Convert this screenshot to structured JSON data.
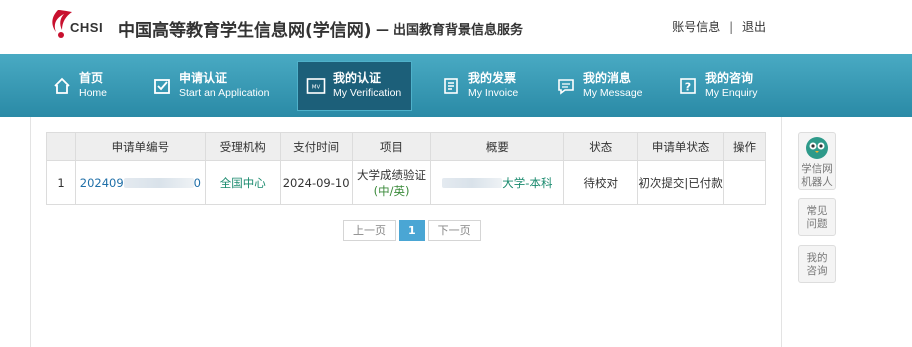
{
  "header": {
    "logo_text": "CHSI",
    "site_title": "中国高等教育学生信息网(学信网)",
    "site_sub": "出国教育背景信息服务",
    "account_label": "账号信息",
    "logout_label": "退出",
    "brand_red": "#c8102e"
  },
  "nav": {
    "items": [
      {
        "zh": "首页",
        "en": "Home",
        "icon": "home-icon"
      },
      {
        "zh": "申请认证",
        "en": "Start an Application",
        "icon": "checkbox-icon"
      },
      {
        "zh": "我的认证",
        "en": "My Verification",
        "icon": "card-icon",
        "active": true
      },
      {
        "zh": "我的发票",
        "en": "My Invoice",
        "icon": "invoice-icon"
      },
      {
        "zh": "我的消息",
        "en": "My Message",
        "icon": "message-icon"
      },
      {
        "zh": "我的咨询",
        "en": "My Enquiry",
        "icon": "question-icon"
      }
    ],
    "bar_color": "#3b9bb7",
    "active_color": "#1c5f79"
  },
  "table": {
    "columns": [
      "申请单编号",
      "受理机构",
      "支付时间",
      "项目",
      "概要",
      "状态",
      "申请单状态",
      "操作"
    ],
    "rows": [
      {
        "index": "1",
        "order_id_visible": "202409",
        "order_id_tail": "0",
        "agency": "全国中心",
        "pay_time": "2024-09-10",
        "project_line1": "大学成绩验证",
        "project_line2": "(中/英)",
        "summary_visible": "大学-本科",
        "status": "待校对",
        "order_status": "初次提交|已付款",
        "operation": ""
      }
    ]
  },
  "pager": {
    "prev_label": "上一页",
    "current_page": "1",
    "next_label": "下一页"
  },
  "tools": {
    "robot_label_1": "学信网",
    "robot_label_2": "机器人",
    "faq_label_1": "常见",
    "faq_label_2": "问题",
    "enquiry_label_1": "我的",
    "enquiry_label_2": "咨询"
  }
}
